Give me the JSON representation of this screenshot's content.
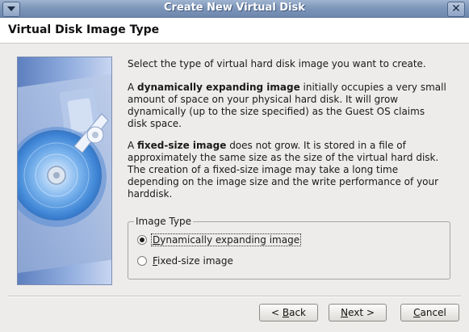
{
  "window": {
    "title": "Create New Virtual Disk",
    "close_glyph": "✕"
  },
  "header": {
    "heading": "Virtual Disk Image Type"
  },
  "side_image": {
    "icon": "hard-disk-illustration"
  },
  "body": {
    "intro": "Select the type of virtual hard disk image you want to create.",
    "dynamic": {
      "lead": "A ",
      "term": "dynamically expanding image",
      "rest": " initially occupies a very small amount of space on your physical hard disk. It will grow dynamically (up to the size specified) as the Guest OS claims disk space."
    },
    "fixed": {
      "lead": "A ",
      "term": "fixed-size image",
      "rest": " does not grow. It is stored in a file of approximately the same size as the size of the virtual hard disk. The creation of a fixed-size image may take a long time depending on the image size and the write performance of your harddisk."
    }
  },
  "image_type": {
    "legend": "Image Type",
    "options": [
      {
        "mnemonic": "D",
        "rest": "ynamically expanding image",
        "checked": true
      },
      {
        "mnemonic": "F",
        "rest": "ixed-size image",
        "checked": false
      }
    ]
  },
  "buttons": {
    "back": {
      "prefix": "< ",
      "mnemonic": "B",
      "rest": "ack"
    },
    "next": {
      "mnemonic": "N",
      "rest": "ext >"
    },
    "cancel": {
      "mnemonic": "C",
      "rest": "ancel"
    }
  },
  "colors": {
    "titlebar": "#7f97bb",
    "panel_blue": "#5d7fbf"
  }
}
